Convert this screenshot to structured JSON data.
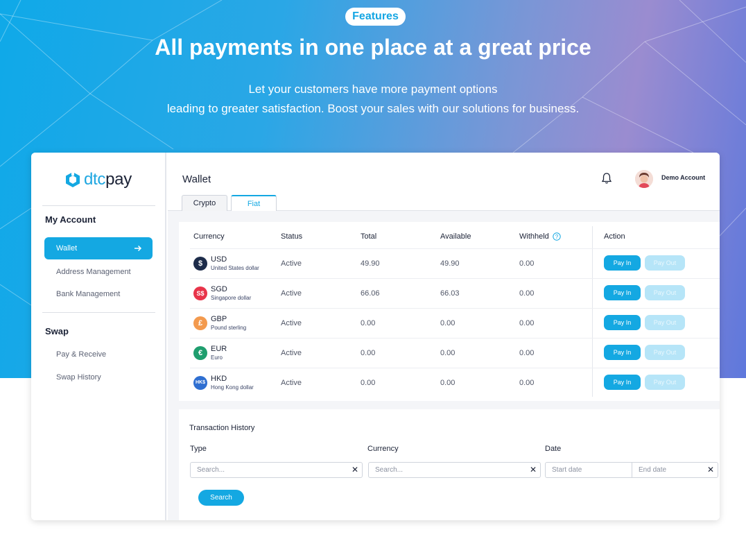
{
  "hero": {
    "badge": "Features",
    "headline": "All payments in one place at a great price",
    "subline1": "Let your customers have more payment options",
    "subline2": "leading to greater satisfaction. Boost your sales with our solutions for business."
  },
  "colors": {
    "brand": "#14a8e2",
    "pay_out_disabled": "#b6e5f8",
    "text_dark": "#1b2236"
  },
  "sidebar": {
    "logo_prefix": "dtc",
    "logo_suffix": "pay",
    "sections": [
      {
        "title": "My Account",
        "items": [
          "Wallet",
          "Address Management",
          "Bank Management"
        ]
      },
      {
        "title": "Swap",
        "items": [
          "Pay & Receive",
          "Swap History"
        ]
      }
    ],
    "active_item": "Wallet"
  },
  "header": {
    "title": "Wallet",
    "account_name": "Demo Account",
    "tabs": [
      {
        "label": "Crypto",
        "active": false
      },
      {
        "label": "Fiat",
        "active": true
      }
    ]
  },
  "table": {
    "columns": [
      "Currency",
      "Status",
      "Total",
      "Available",
      "Withheld",
      "Action"
    ],
    "rows": [
      {
        "icon": "$",
        "icon_color": "#1d2c4a",
        "code": "USD",
        "name": "United States dollar",
        "status": "Active",
        "total": "49.90",
        "available": "49.90",
        "withheld": "0.00",
        "pay_in": "Pay In",
        "pay_out": "Pay Out"
      },
      {
        "icon": "S$",
        "icon_color": "#e8344a",
        "code": "SGD",
        "name": "Singapore dollar",
        "status": "Active",
        "total": "66.06",
        "available": "66.03",
        "withheld": "0.00",
        "pay_in": "Pay In",
        "pay_out": "Pay Out"
      },
      {
        "icon": "£",
        "icon_color": "#f39a4e",
        "code": "GBP",
        "name": "Pound sterling",
        "status": "Active",
        "total": "0.00",
        "available": "0.00",
        "withheld": "0.00",
        "pay_in": "Pay In",
        "pay_out": "Pay Out"
      },
      {
        "icon": "€",
        "icon_color": "#1f9e6e",
        "code": "EUR",
        "name": "Euro",
        "status": "Active",
        "total": "0.00",
        "available": "0.00",
        "withheld": "0.00",
        "pay_in": "Pay In",
        "pay_out": "Pay Out"
      },
      {
        "icon": "HK$",
        "icon_color": "#2f6fd1",
        "code": "HKD",
        "name": "Hong Kong dollar",
        "status": "Active",
        "total": "0.00",
        "available": "0.00",
        "withheld": "0.00",
        "pay_in": "Pay In",
        "pay_out": "Pay Out"
      }
    ]
  },
  "transaction_history": {
    "title": "Transaction History",
    "type_label": "Type",
    "type_placeholder": "Search...",
    "currency_label": "Currency",
    "currency_placeholder": "Search...",
    "date_label": "Date",
    "start_placeholder": "Start date",
    "end_placeholder": "End date",
    "clear_glyph": "✕",
    "search_label": "Search"
  }
}
